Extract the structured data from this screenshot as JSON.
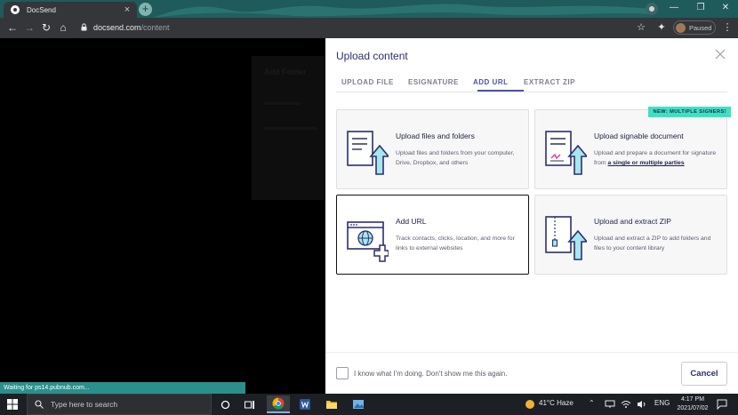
{
  "browser": {
    "tab_title": "DocSend",
    "tab_close": "×",
    "new_tab": "+",
    "url_domain": "docsend.com",
    "url_path": "/content",
    "profile_status": "Paused",
    "status_bar": "Waiting for ps14.pubnub.com...",
    "window_controls": {
      "minimize": "—",
      "maximize": "❐",
      "close": "✕"
    },
    "nav": {
      "back": "←",
      "forward": "→",
      "reload": "↻",
      "home": "⌂"
    },
    "icons": {
      "star": "☆",
      "extensions": "✦",
      "menu": "⋮"
    }
  },
  "background_page": {
    "dialog_title": "Add Folder"
  },
  "modal": {
    "title": "Upload content",
    "tabs": [
      {
        "label": "UPLOAD FILE",
        "active": false
      },
      {
        "label": "ESIGNATURE",
        "active": false
      },
      {
        "label": "ADD URL",
        "active": true
      },
      {
        "label": "EXTRACT ZIP",
        "active": false
      }
    ],
    "cards": [
      {
        "title": "Upload files and folders",
        "description": "Upload files and folders from your computer, Drive, Dropbox, and others",
        "icon": "document-upload-icon"
      },
      {
        "title": "Upload signable document",
        "description_prefix": "Upload and prepare a document for signature from ",
        "description_link": "a single or multiple parties",
        "badge": "NEW: MULTIPLE SIGNERS!",
        "icon": "signable-document-icon"
      },
      {
        "title": "Add URL",
        "description": "Track contacts, clicks, location, and more for links to external websites",
        "icon": "browser-globe-icon",
        "selected": true
      },
      {
        "title": "Upload and extract ZIP",
        "description": "Upload and extract a ZIP to add folders and files to your content library",
        "icon": "zip-file-icon"
      }
    ],
    "checkbox_label": "I know what I'm doing. Don't show me this again.",
    "cancel_label": "Cancel"
  },
  "taskbar": {
    "search_placeholder": "Type here to search",
    "weather": "41°C  Haze",
    "language": "ENG",
    "time": "4:17 PM",
    "date": "2021/07/02",
    "tray_arrow": "⌃"
  },
  "colors": {
    "accent": "#4d4fb6",
    "title": "#2b2f6e",
    "badge": "#3fe0c0",
    "tabstrip": "#1f5b5a",
    "chrome_toolbar": "#35363a"
  }
}
